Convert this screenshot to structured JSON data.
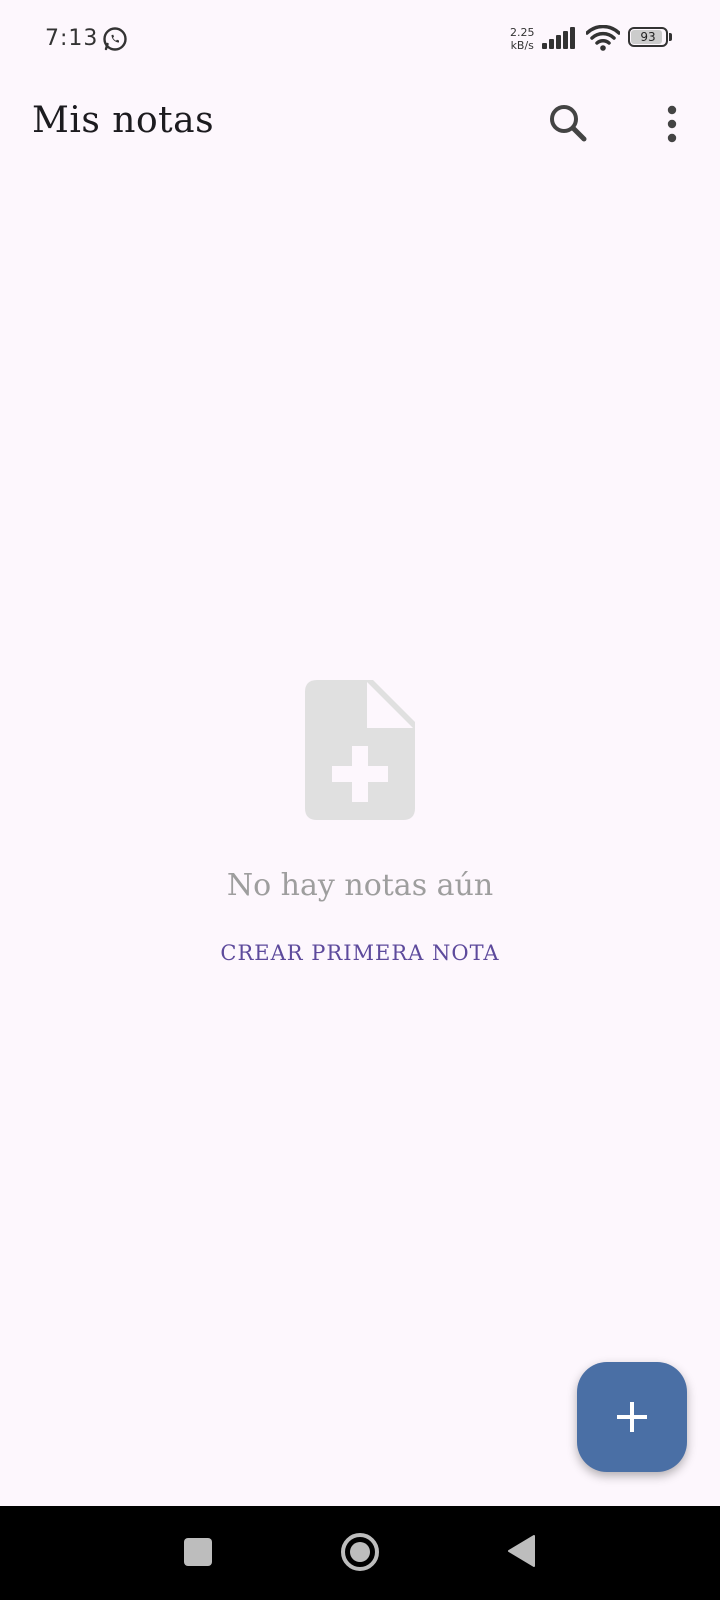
{
  "status_bar": {
    "time": "7:13",
    "net_speed_value": "2.25",
    "net_speed_unit": "kB/s",
    "battery": "93",
    "icons": [
      "whatsapp-icon",
      "signal-icon",
      "wifi-icon",
      "battery-icon"
    ]
  },
  "app_bar": {
    "title": "Mis notas",
    "actions": [
      "search-icon",
      "more-vert-icon"
    ]
  },
  "empty_state": {
    "icon": "note-add-icon",
    "message": "No hay notas aún",
    "action_label": "CREAR PRIMERA NOTA"
  },
  "fab": {
    "icon": "plus-icon"
  },
  "nav_bar": {
    "buttons": [
      "recents-icon",
      "home-icon",
      "back-icon"
    ]
  },
  "colors": {
    "background": "#fdf7fd",
    "accent": "#5d4a9c",
    "fab": "#4a6fa5",
    "muted_text": "#9e9e9e"
  }
}
